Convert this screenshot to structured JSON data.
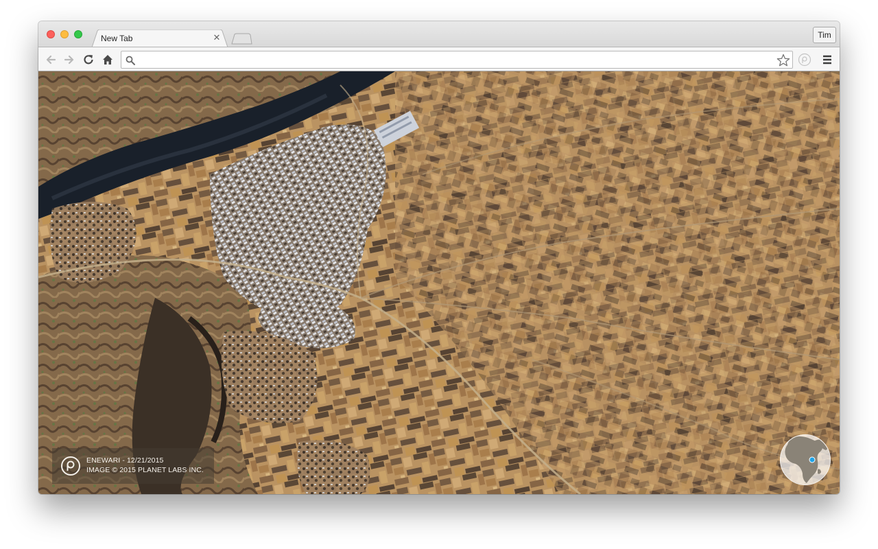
{
  "browser": {
    "tab": {
      "title": "New Tab",
      "close_icon": "close-icon"
    },
    "new_tab_icon": "new-tab-icon",
    "profile_label": "Tim",
    "toolbar": {
      "back_icon": "back-arrow-icon",
      "forward_icon": "forward-arrow-icon",
      "reload_icon": "reload-icon",
      "home_icon": "home-icon",
      "omnibox": {
        "value": "",
        "search_icon": "search-icon",
        "bookmark_icon": "star-icon"
      },
      "extension_icon": "planet-extension-icon",
      "menu_icon": "hamburger-menu-icon"
    }
  },
  "caption": {
    "line1": "ENEWARI - 12/21/2015",
    "line2": "IMAGE © 2015 PLANET LABS INC.",
    "logo_icon": "planet-logo-icon"
  },
  "globe": {
    "icon": "globe-location-icon"
  },
  "colors": {
    "field_tan": "#c29a66",
    "field_dark": "#6e5640",
    "river": "#1c2430",
    "traffic_red": "#fc605c",
    "traffic_yellow": "#fdbc40",
    "traffic_green": "#34c84a",
    "location_dot": "#1ea3e8"
  }
}
